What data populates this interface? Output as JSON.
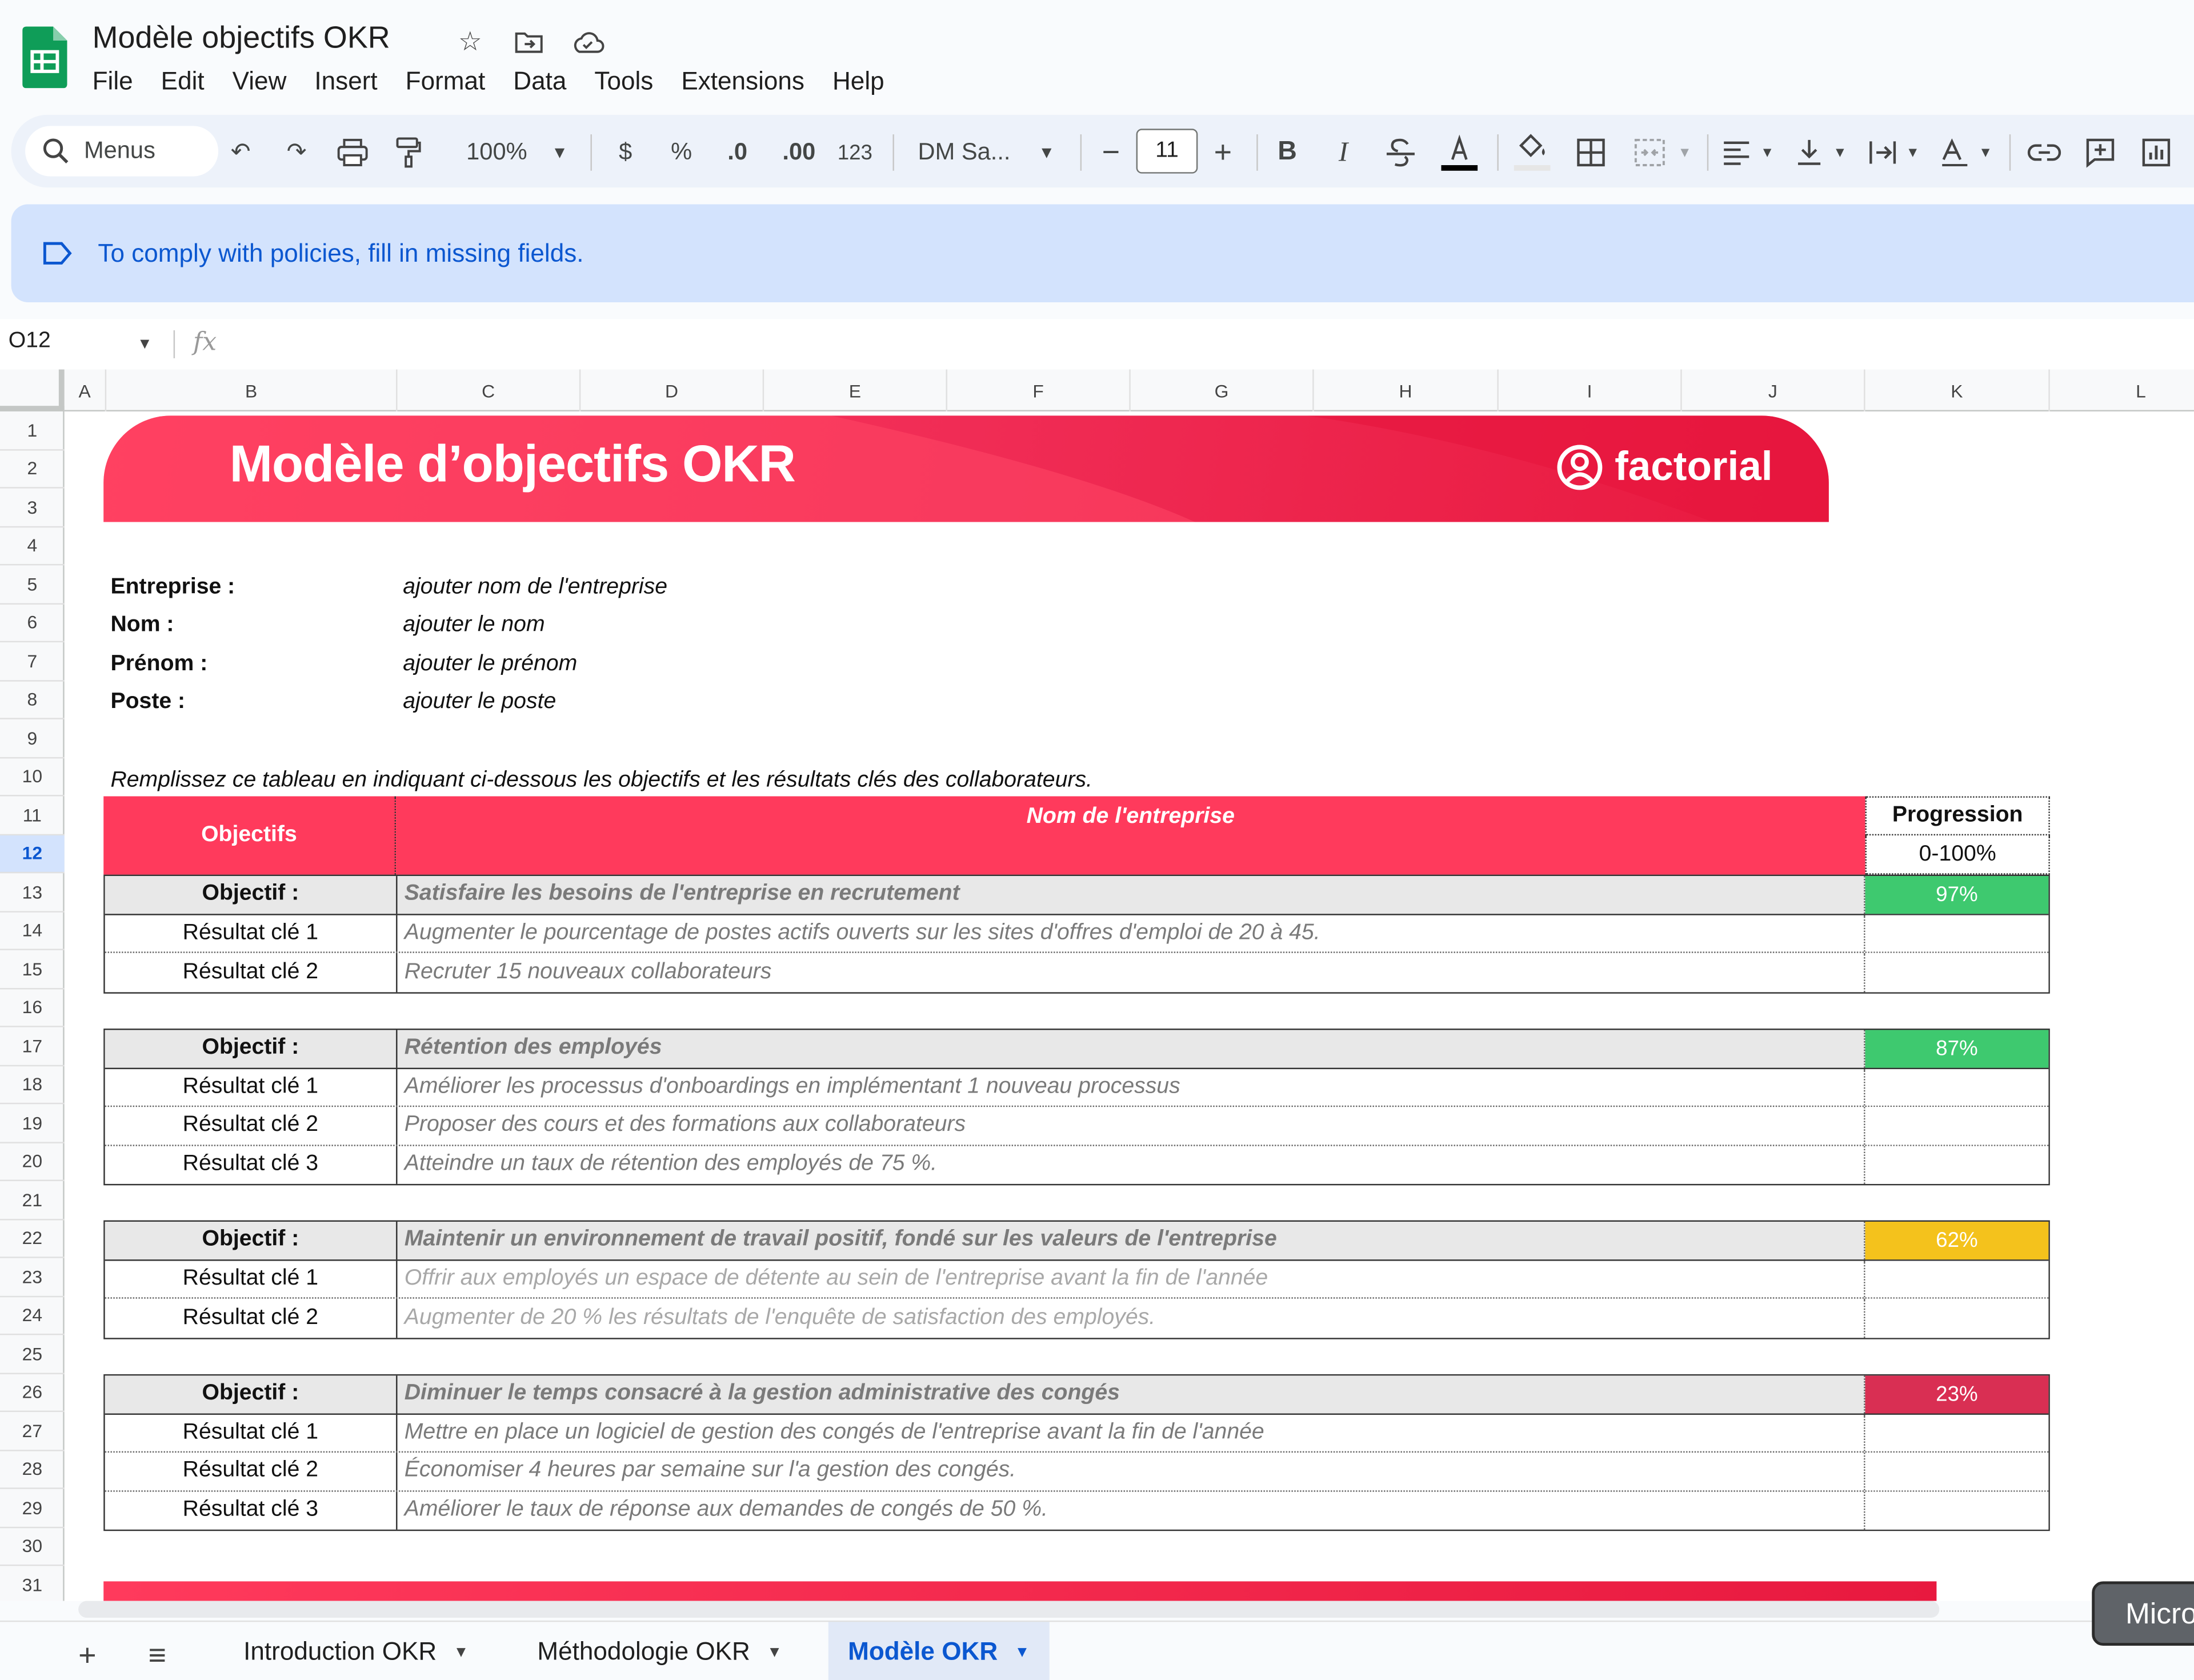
{
  "app": {
    "doc_title": "Modèle objectifs OKR",
    "menu": [
      "File",
      "Edit",
      "View",
      "Insert",
      "Format",
      "Data",
      "Tools",
      "Extensions",
      "Help"
    ]
  },
  "toolbar": {
    "menus_label": "Menus",
    "zoom": "100%",
    "currency": "$",
    "percent": "%",
    "dec_decrease": ".0",
    "dec_increase": ".00",
    "number_format": "123",
    "font": "DM Sa...",
    "font_size": "11",
    "minus": "−",
    "plus": "+",
    "bold": "B",
    "italic": "I"
  },
  "banner": {
    "text": "To comply with policies, fill in missing fields."
  },
  "formula_bar": {
    "cell_ref": "O12",
    "fx": "fx"
  },
  "columns": [
    "A",
    "B",
    "C",
    "D",
    "E",
    "F",
    "G",
    "H",
    "I",
    "J",
    "K",
    "L"
  ],
  "rows": [
    "1",
    "2",
    "3",
    "4",
    "5",
    "6",
    "7",
    "8",
    "9",
    "10",
    "11",
    "12",
    "13",
    "14",
    "15",
    "16",
    "17",
    "18",
    "19",
    "20",
    "21",
    "22",
    "23",
    "24",
    "25",
    "26",
    "27",
    "28",
    "29",
    "30",
    "31"
  ],
  "selected_row": "12",
  "sheet": {
    "header_title": "Modèle d’objectifs OKR",
    "brand": "factorial",
    "info": [
      {
        "label": "Entreprise :",
        "value": "ajouter nom de l'entreprise"
      },
      {
        "label": "Nom :",
        "value": "ajouter le nom"
      },
      {
        "label": "Prénom :",
        "value": "ajouter le prénom"
      },
      {
        "label": "Poste :",
        "value": "ajouter le poste"
      }
    ],
    "instructions": "Remplissez ce tableau en indiquant ci-dessous les objectifs et les résultats clés des collaborateurs.",
    "table_head": {
      "objectives": "Objectifs",
      "company": "Nom de l'entreprise",
      "progress": "Progression",
      "range": "0-100%"
    },
    "blocks": [
      {
        "objective_label": "Objectif :",
        "objective": "Satisfaire les besoins de l'entreprise en recrutement",
        "progress": "97%",
        "color": "#3ec96f",
        "key_results": [
          {
            "label": "Résultat clé 1",
            "text": "Augmenter le pourcentage de postes actifs ouverts sur les sites d'offres d'emploi de 20 à 45."
          },
          {
            "label": "Résultat clé 2",
            "text": "Recruter 15 nouveaux collaborateurs"
          }
        ]
      },
      {
        "objective_label": "Objectif :",
        "objective": "Rétention des employés",
        "progress": "87%",
        "color": "#3ec96f",
        "key_results": [
          {
            "label": "Résultat clé 1",
            "text": "Améliorer les processus d'onboardings en implémentant 1 nouveau processus"
          },
          {
            "label": "Résultat clé 2",
            "text": "Proposer des cours et des formations aux collaborateurs"
          },
          {
            "label": "Résultat clé 3",
            "text": "Atteindre un taux de rétention des employés de 75 %."
          }
        ]
      },
      {
        "objective_label": "Objectif :",
        "objective": "Maintenir un environnement de travail positif, fondé sur les valeurs de l'entreprise",
        "progress": "62%",
        "color": "#f4c21c",
        "key_results": [
          {
            "label": "Résultat clé 1",
            "text": "Offrir aux employés un espace de détente au sein de l'entreprise avant la fin de l'année"
          },
          {
            "label": "Résultat clé 2",
            "text": "Augmenter de 20 % les résultats de l'enquête de satisfaction des employés."
          }
        ]
      },
      {
        "objective_label": "Objectif :",
        "objective": "Diminuer le temps consacré à la gestion administrative des congés",
        "progress": "23%",
        "color": "#d92f53",
        "key_results": [
          {
            "label": "Résultat clé 1",
            "text": "Mettre en place un logiciel de gestion des congés de l'entreprise avant la fin de l'année"
          },
          {
            "label": "Résultat clé 2",
            "text": "Économiser 4 heures par semaine sur l'a gestion des congés."
          },
          {
            "label": "Résultat clé 3",
            "text": "Améliorer le taux de réponse aux demandes de congés de 50 %."
          }
        ]
      }
    ]
  },
  "tabs": [
    {
      "label": "Introduction OKR",
      "active": false
    },
    {
      "label": "Méthodologie OKR",
      "active": false
    },
    {
      "label": "Modèle OKR",
      "active": true
    }
  ],
  "popup": {
    "text": "Micro"
  }
}
